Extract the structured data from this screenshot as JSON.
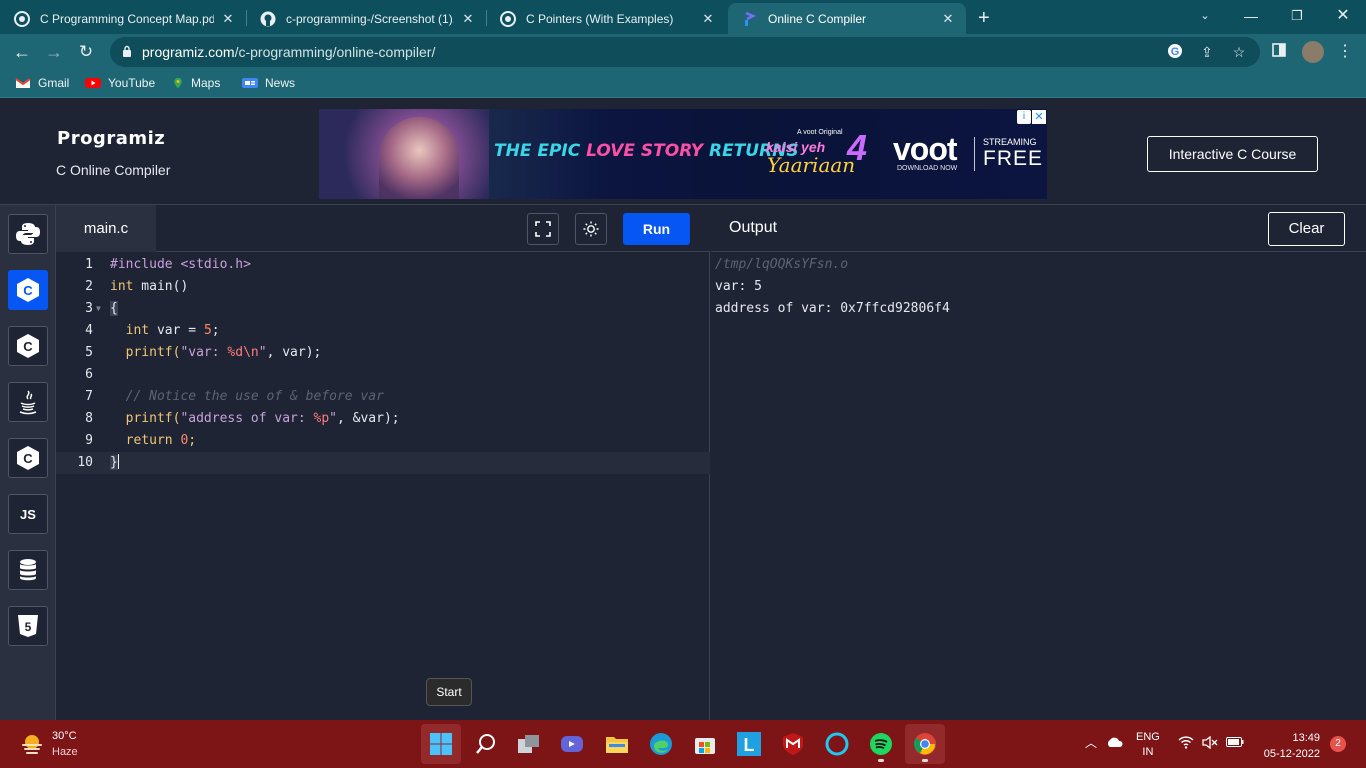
{
  "browser": {
    "tabs": [
      {
        "title": "C Programming Concept Map.pd",
        "icon": "pdf-icon"
      },
      {
        "title": "c-programming-/Screenshot (1).",
        "icon": "github-icon"
      },
      {
        "title": "C Pointers (With Examples)",
        "icon": "programiz-icon"
      },
      {
        "title": "Online C Compiler",
        "icon": "programiz-icon",
        "active": true
      }
    ],
    "url_domain": "programiz.com",
    "url_path": "/c-programming/online-compiler/",
    "bookmarks": [
      "Gmail",
      "YouTube",
      "Maps",
      "News"
    ]
  },
  "site": {
    "logo": "Programiz",
    "subtitle": "C Online Compiler",
    "course_button": "Interactive C Course",
    "ad": {
      "tagline_1": "THE EPIC ",
      "tagline_2": "LOVE STORY",
      "tagline_3": " RETURNS",
      "original": "A voot Original",
      "show_1": "kaisi yeh",
      "show_2": "Yaariaan",
      "show_num": "4",
      "brand": "voot",
      "download": "DOWNLOAD NOW",
      "streaming": "STREAMING",
      "free": "FREE"
    }
  },
  "sidebar": {
    "languages": [
      "python",
      "c",
      "cpp",
      "java",
      "csharp",
      "JS",
      "sql",
      "html5"
    ],
    "js_label": "JS"
  },
  "editor": {
    "file_name": "main.c",
    "run_label": "Run",
    "line_numbers": [
      "1",
      "2",
      "3",
      "4",
      "5",
      "6",
      "7",
      "8",
      "9",
      "10"
    ],
    "code": {
      "l1a": "#include ",
      "l1b": "<stdio.h>",
      "l2a": "int",
      "l2b": " main()",
      "l3": "{",
      "l4a": "  int",
      "l4b": " var = ",
      "l4c": "5",
      "l4d": ";",
      "l5a": "  printf(",
      "l5b": "\"var: ",
      "l5c": "%d\\n",
      "l5d": "\"",
      "l5e": ", var);",
      "l7": "  // Notice the use of & before var",
      "l8a": "  printf(",
      "l8b": "\"address of var: ",
      "l8c": "%p",
      "l8d": "\"",
      "l8e": ", &var);",
      "l9a": "  return",
      "l9b": " 0",
      "l9c": ";",
      "l10": "}"
    },
    "tooltip": "Start"
  },
  "output": {
    "title": "Output",
    "clear_label": "Clear",
    "lines": [
      "/tmp/lqOQKsYFsn.o",
      "var: 5",
      "address of var: 0x7ffcd92806f4"
    ]
  },
  "taskbar": {
    "weather_temp": "30°C",
    "weather_desc": "Haze",
    "lang_1": "ENG",
    "lang_2": "IN",
    "time": "13:49",
    "date": "05-12-2022",
    "notifications": "2",
    "apps": [
      "windows-start",
      "search",
      "task-view",
      "teams-chat",
      "file-explorer",
      "edge",
      "microsoft-store",
      "l-app",
      "mcafee",
      "alexa",
      "spotify",
      "chrome"
    ]
  },
  "colors": {
    "accent": "#0556f3",
    "background": "#1e2434",
    "chrome_tab": "#1f6674",
    "taskbar": "#7d1517"
  }
}
